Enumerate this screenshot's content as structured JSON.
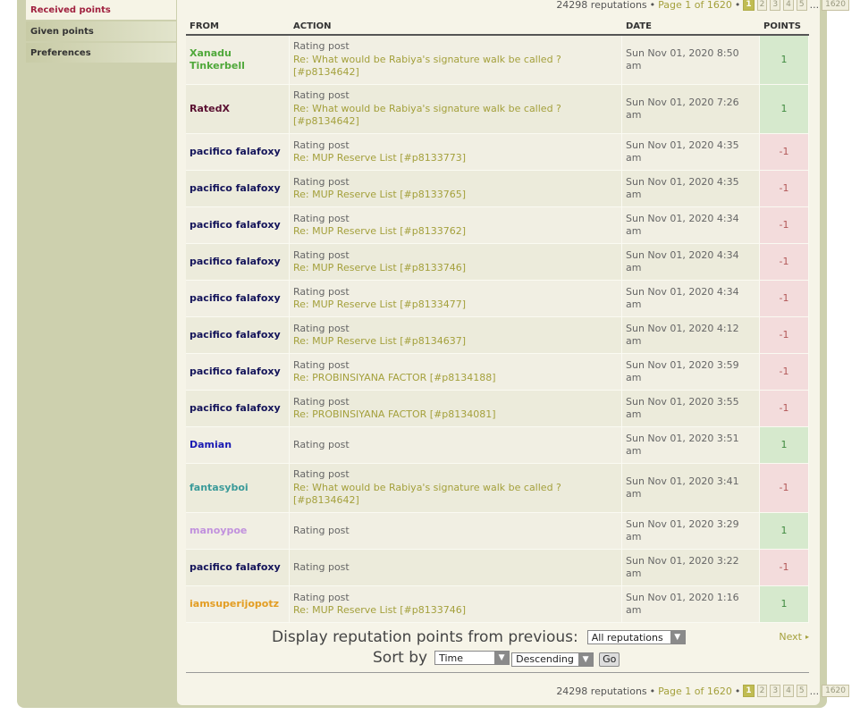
{
  "sidebar": {
    "items": [
      {
        "label": "Received points",
        "active": true
      },
      {
        "label": "Given points",
        "active": false
      },
      {
        "label": "Preferences",
        "active": false
      }
    ]
  },
  "pagination": {
    "count_text": "24298 reputations",
    "bullet": "•",
    "page_text": "Page 1 of 1620",
    "pages": [
      "1",
      "2",
      "3",
      "4",
      "5"
    ],
    "ellipsis": "...",
    "last_page": "1620"
  },
  "table": {
    "headers": {
      "from": "FROM",
      "action": "ACTION",
      "date": "DATE",
      "points": "POINTS"
    },
    "rows": [
      {
        "from": "Xanadu Tinkerbell",
        "color": "#4fa83a",
        "action": "Rating post",
        "link": "Re: What would be Rabiya's signature walk be called ? [#p8134642]",
        "date": "Sun Nov 01, 2020 8:50 am",
        "points": "1"
      },
      {
        "from": "RatedX",
        "color": "#5a1031",
        "action": "Rating post",
        "link": "Re: What would be Rabiya's signature walk be called ? [#p8134642]",
        "date": "Sun Nov 01, 2020 7:26 am",
        "points": "1"
      },
      {
        "from": "pacifico falafoxy",
        "color": "#14145a",
        "action": "Rating post",
        "link": "Re: MUP Reserve List [#p8133773]",
        "date": "Sun Nov 01, 2020 4:35 am",
        "points": "-1"
      },
      {
        "from": "pacifico falafoxy",
        "color": "#14145a",
        "action": "Rating post",
        "link": "Re: MUP Reserve List [#p8133765]",
        "date": "Sun Nov 01, 2020 4:35 am",
        "points": "-1"
      },
      {
        "from": "pacifico falafoxy",
        "color": "#14145a",
        "action": "Rating post",
        "link": "Re: MUP Reserve List [#p8133762]",
        "date": "Sun Nov 01, 2020 4:34 am",
        "points": "-1"
      },
      {
        "from": "pacifico falafoxy",
        "color": "#14145a",
        "action": "Rating post",
        "link": "Re: MUP Reserve List [#p8133746]",
        "date": "Sun Nov 01, 2020 4:34 am",
        "points": "-1"
      },
      {
        "from": "pacifico falafoxy",
        "color": "#14145a",
        "action": "Rating post",
        "link": "Re: MUP Reserve List [#p8133477]",
        "date": "Sun Nov 01, 2020 4:34 am",
        "points": "-1"
      },
      {
        "from": "pacifico falafoxy",
        "color": "#14145a",
        "action": "Rating post",
        "link": "Re: MUP Reserve List [#p8134637]",
        "date": "Sun Nov 01, 2020 4:12 am",
        "points": "-1"
      },
      {
        "from": "pacifico falafoxy",
        "color": "#14145a",
        "action": "Rating post",
        "link": "Re: PROBINSIYANA FACTOR [#p8134188]",
        "date": "Sun Nov 01, 2020 3:59 am",
        "points": "-1"
      },
      {
        "from": "pacifico falafoxy",
        "color": "#14145a",
        "action": "Rating post",
        "link": "Re: PROBINSIYANA FACTOR [#p8134081]",
        "date": "Sun Nov 01, 2020 3:55 am",
        "points": "-1"
      },
      {
        "from": "Damian",
        "color": "#1a1ab3",
        "action": "Rating post",
        "link": "",
        "date": "Sun Nov 01, 2020 3:51 am",
        "points": "1"
      },
      {
        "from": "fantasyboi",
        "color": "#3a9a99",
        "action": "Rating post",
        "link": "Re: What would be Rabiya's signature walk be called ? [#p8134642]",
        "date": "Sun Nov 01, 2020 3:41 am",
        "points": "-1"
      },
      {
        "from": "manoypoe",
        "color": "#c191dd",
        "action": "Rating post",
        "link": "",
        "date": "Sun Nov 01, 2020 3:29 am",
        "points": "1"
      },
      {
        "from": "pacifico falafoxy",
        "color": "#14145a",
        "action": "Rating post",
        "link": "",
        "date": "Sun Nov 01, 2020 3:22 am",
        "points": "-1"
      },
      {
        "from": "iamsuperijopotz",
        "color": "#e39d23",
        "action": "Rating post",
        "link": "Re: MUP Reserve List [#p8133746]",
        "date": "Sun Nov 01, 2020 1:16 am",
        "points": "1"
      }
    ]
  },
  "filter": {
    "display_label": "Display reputation points from previous:",
    "display_value": "All reputations",
    "sort_label": "Sort by",
    "sort_key": "Time",
    "sort_dir": "Descending",
    "go": "Go",
    "next": "Next"
  },
  "colors": {
    "accent": "#a4a03c",
    "positive_bg": "#d6e9cd",
    "negative_bg": "#f3dcdc",
    "active_nav": "#a0213f"
  }
}
